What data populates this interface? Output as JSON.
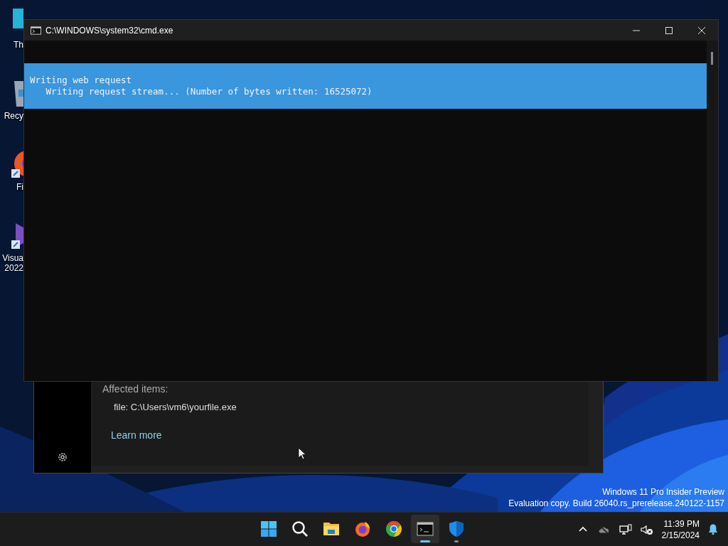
{
  "desktop_icons": [
    {
      "label": "Th",
      "kind": "monitor"
    },
    {
      "label": "Recy",
      "kind": "bin"
    },
    {
      "label": "Fi",
      "kind": "browser"
    },
    {
      "label": "Visua\n2022",
      "kind": "studio"
    }
  ],
  "background_window": {
    "section_heading": "Affected items:",
    "item": "file: C:\\Users\\vm6\\yourfile.exe",
    "link": "Learn more"
  },
  "console_window": {
    "title": "C:\\WINDOWS\\system32\\cmd.exe",
    "progress_lines": [
      "Writing web request",
      "   Writing request stream... (Number of bytes written: 16525072)"
    ]
  },
  "watermark_lines": [
    "Windows 11 Pro Insider Preview",
    "Evaluation copy. Build 26040.rs_prerelease.240122-1157"
  ],
  "taskbar": {
    "apps": [
      {
        "kind": "start",
        "selected": false,
        "running": false
      },
      {
        "kind": "search",
        "selected": false,
        "running": false
      },
      {
        "kind": "explorer",
        "selected": false,
        "running": false
      },
      {
        "kind": "firefox",
        "selected": false,
        "running": false
      },
      {
        "kind": "chrome",
        "selected": false,
        "running": false
      },
      {
        "kind": "terminal",
        "selected": true,
        "running": true
      },
      {
        "kind": "shield",
        "selected": false,
        "running": true
      }
    ],
    "time": "11:39 PM",
    "date": "2/15/2024"
  }
}
